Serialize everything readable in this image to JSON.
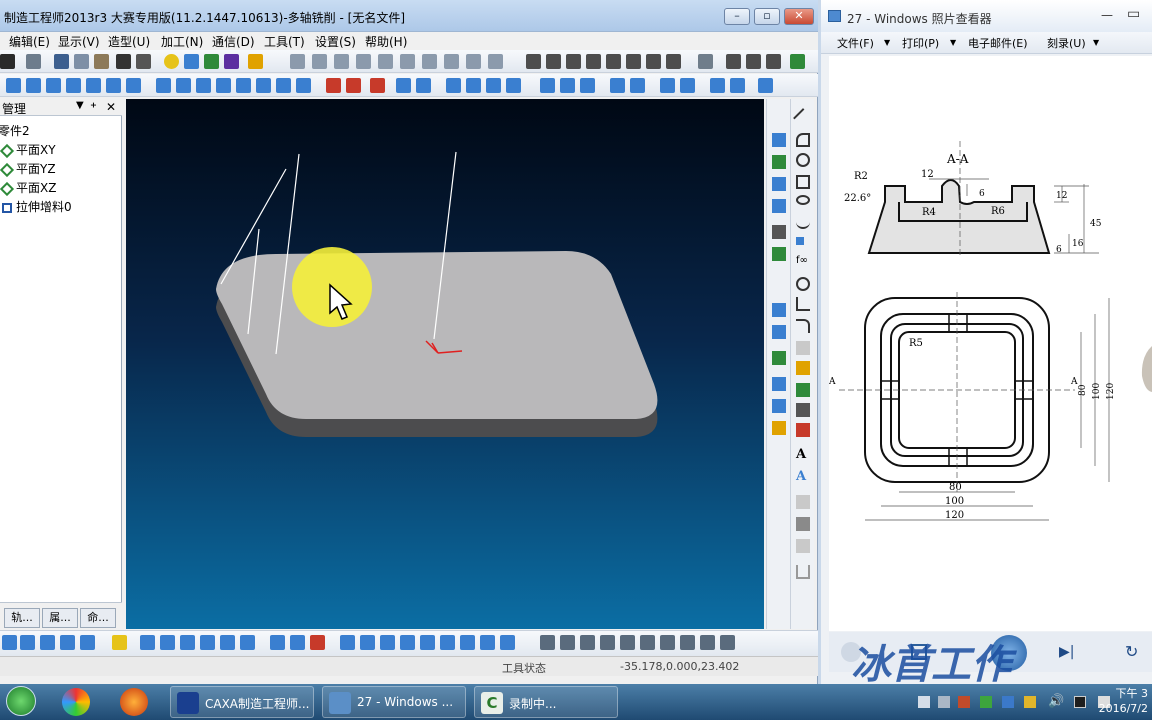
{
  "app": {
    "title": "制造工程师2013r3 大赛专用版(11.2.1447.10613)-多轴铣削 - [无名文件]",
    "menu": [
      "编辑(E)",
      "显示(V)",
      "造型(U)",
      "加工(N)",
      "通信(D)",
      "工具(T)",
      "设置(S)",
      "帮助(H)"
    ],
    "panel": {
      "title": "管理",
      "tree": [
        "零件2",
        "平面XY",
        "平面YZ",
        "平面XZ",
        "拉伸增料0"
      ],
      "tabs": [
        "轨...",
        "属...",
        "命..."
      ]
    },
    "status": {
      "tool_state_label": "工具状态",
      "coordinates": "-35.178,0.000,23.402"
    },
    "colors": {
      "accent": "#0b6ea4",
      "cursor_highlight": "#f5f03a",
      "part": "#b9b8ba"
    }
  },
  "viewer": {
    "title": "27 - Windows 照片查看器",
    "menu": [
      "文件(F)",
      "打印(P)",
      "电子邮件(E)",
      "刻录(U)"
    ],
    "drawing": {
      "section_title": "A-A",
      "dims_top": [
        "R2",
        "22.6°",
        "12",
        "6",
        "12",
        "R4",
        "R6",
        "45",
        "6",
        "16"
      ],
      "dims_plan": [
        "R5",
        "A",
        "A",
        "80",
        "100",
        "120",
        "80",
        "100",
        "120"
      ]
    },
    "watermark": "冰首工作"
  },
  "taskbar": {
    "items": [
      "CAXA制造工程师...",
      "27 - Windows ...",
      "录制中..."
    ],
    "clock_time": "下午 3",
    "clock_date": "2016/7/2"
  }
}
